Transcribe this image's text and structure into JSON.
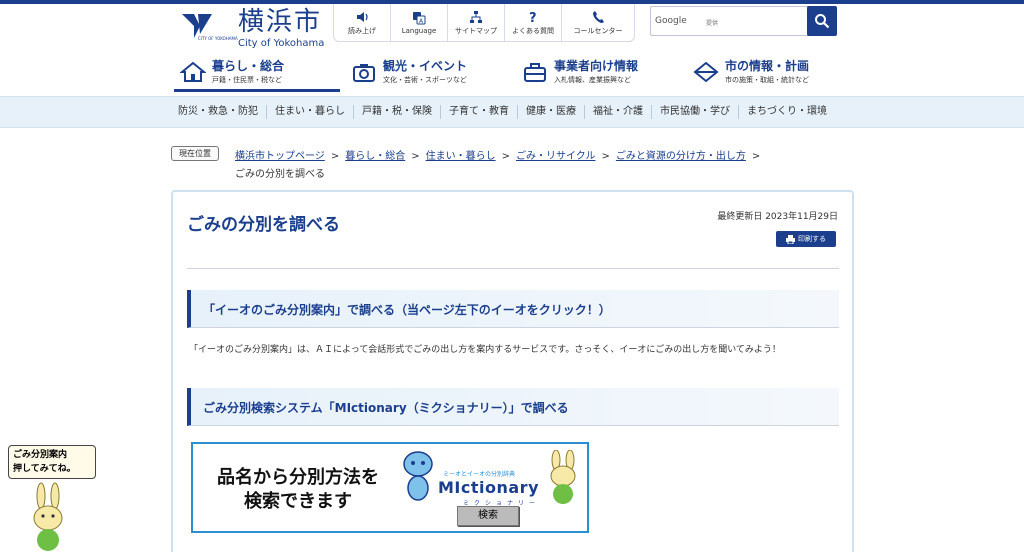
{
  "header": {
    "logo_text": "横浜市",
    "logo_en": "City of Yokohama",
    "logo_sub": "CITY OF YOKOHAMA",
    "utility": [
      {
        "label": "読み上げ",
        "icon": "speaker-icon"
      },
      {
        "label": "Language",
        "icon": "translate-icon"
      },
      {
        "label": "サイトマップ",
        "icon": "sitemap-icon"
      },
      {
        "label": "よくある質問",
        "icon": "question-icon"
      },
      {
        "label": "コールセンター",
        "icon": "phone-icon"
      }
    ],
    "search": {
      "brand": "Google",
      "sub": "提供"
    }
  },
  "gnav": [
    {
      "title": "暮らし・総合",
      "sub": "戸籍・住民票・税など",
      "icon": "home-icon",
      "active": true
    },
    {
      "title": "観光・イベント",
      "sub": "文化・芸術・スポーツなど",
      "icon": "camera-icon",
      "active": false
    },
    {
      "title": "事業者向け情報",
      "sub": "入札情報、産業振興など",
      "icon": "briefcase-icon",
      "active": false
    },
    {
      "title": "市の情報・計画",
      "sub": "市の施策・取組・統計など",
      "icon": "diamond-icon",
      "active": false
    }
  ],
  "subnav": [
    "防災・救急・防犯",
    "住まい・暮らし",
    "戸籍・税・保険",
    "子育て・教育",
    "健康・医療",
    "福祉・介護",
    "市民協働・学び",
    "まちづくり・環境"
  ],
  "breadcrumb": {
    "badge": "現在位置",
    "links": [
      "横浜市トップページ",
      "暮らし・総合",
      "住まい・暮らし",
      "ごみ・リサイクル",
      "ごみと資源の分け方・出し方"
    ],
    "sep": ">",
    "current": "ごみの分別を調べる"
  },
  "main": {
    "title": "ごみの分別を調べる",
    "updated": "最終更新日 2023年11月29日",
    "print_label": "印刷する",
    "section1_heading": "「イーオのごみ分別案内」で調べる（当ページ左下のイーオをクリック！）",
    "section1_text": "「イーオのごみ分別案内」は、ＡＩによって会話形式でごみの出し方を案内するサービスです。さっそく、イーオにごみの出し方を聞いてみよう！",
    "section2_heading": "ごみ分別検索システム「MIctionary（ミクショナリー）」で調べる",
    "banner": {
      "line1": "品名から分別方法を",
      "line2": "検索できます",
      "ribbon": "ミーオとイーオの分別辞典",
      "logo": "MIctionary",
      "kana": "ミクショナリー",
      "button": "検索"
    }
  },
  "chatbot": {
    "line1": "ごみ分別案内",
    "line2": "押してみてね。"
  },
  "colors": {
    "primary": "#1c3f8d",
    "subnav_bg": "#e6f1f9",
    "banner_border": "#2c8fd0"
  }
}
